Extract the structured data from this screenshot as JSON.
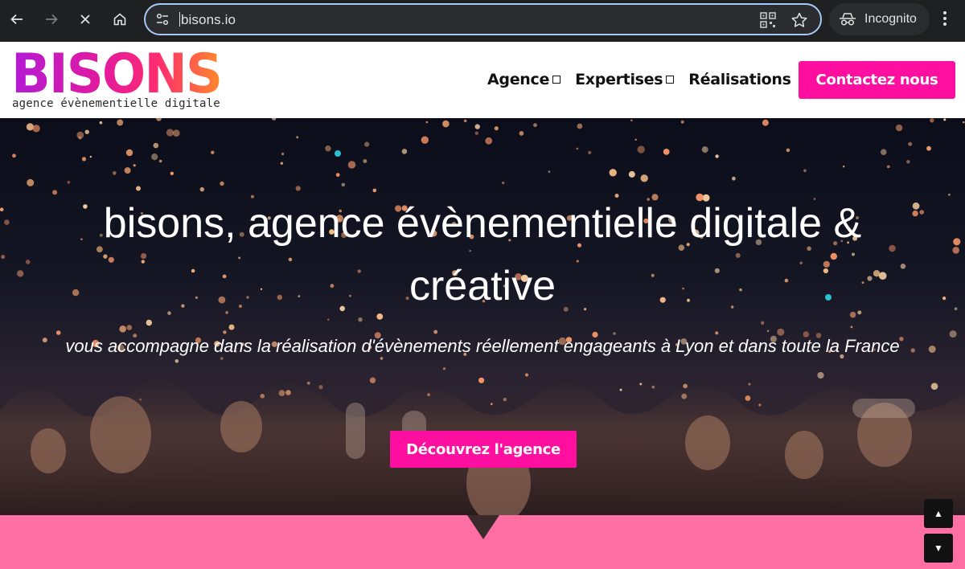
{
  "browser": {
    "url": "bisons.io",
    "incognito_label": "Incognito",
    "icons": [
      "back-icon",
      "forward-icon",
      "stop-icon",
      "home-icon",
      "tune-icon",
      "qr-code-icon",
      "star-icon",
      "incognito-icon",
      "more-vert-icon"
    ]
  },
  "header": {
    "logo_word": "BISONS",
    "logo_tagline": "agence évènementielle digitale",
    "nav": [
      {
        "label": "Agence"
      },
      {
        "label": "Expertises"
      },
      {
        "label": "Réalisations"
      }
    ],
    "cta_label": "Contactez nous"
  },
  "hero": {
    "title": "bisons, agence évènementielle digitale & créative",
    "subtitle": "vous accompagne dans la réalisation d'évènements réellement engageants à Lyon et dans toute la France",
    "button_label": "Découvrez l'agence"
  },
  "scroll_controls": {
    "up_glyph": "▲",
    "down_glyph": "▼"
  },
  "colors": {
    "brand_pink": "#ff0fa0",
    "band_pink": "#ff6fa3",
    "chrome_bg": "#1f2022"
  }
}
